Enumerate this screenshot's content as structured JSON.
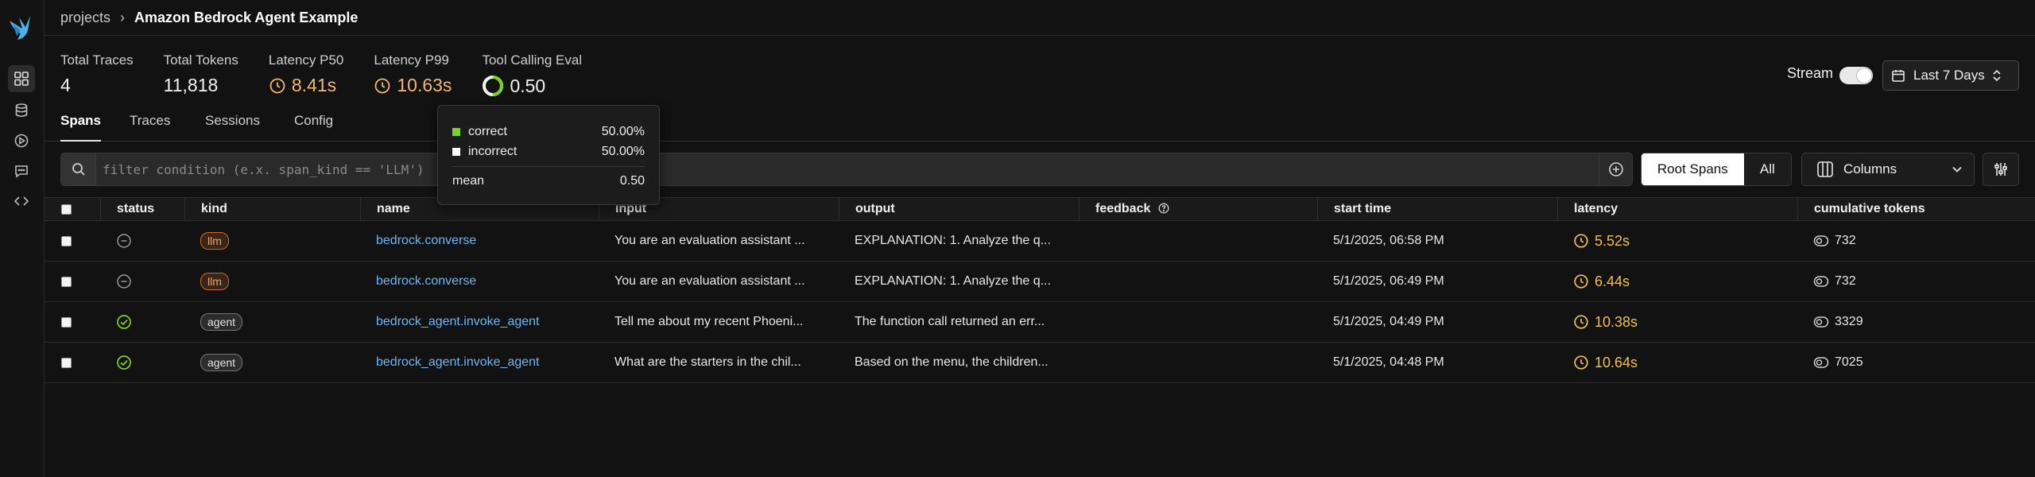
{
  "breadcrumb": {
    "root": "projects",
    "separator": "›",
    "current": "Amazon Bedrock Agent Example"
  },
  "stats": [
    {
      "label": "Total Traces",
      "value": "4"
    },
    {
      "label": "Total Tokens",
      "value": "11,818"
    },
    {
      "label": "Latency P50",
      "value": "8.41s"
    },
    {
      "label": "Latency P99",
      "value": "10.63s"
    },
    {
      "label": "Tool Calling Eval",
      "value": "0.50"
    }
  ],
  "eval_ring": {
    "correct_fraction": 0.5,
    "correct_color": "#7ed321"
  },
  "stream": {
    "label": "Stream",
    "on": true
  },
  "time_range": {
    "label": "Last 7 Days"
  },
  "tabs": [
    "Spans",
    "Traces",
    "Sessions",
    "Config"
  ],
  "filter": {
    "placeholder": "filter condition (e.x. span_kind == 'LLM')"
  },
  "scope": {
    "root": "Root Spans",
    "all": "All"
  },
  "columns_button": "Columns",
  "table": {
    "headers": [
      "status",
      "kind",
      "name",
      "input",
      "output",
      "feedback",
      "start time",
      "latency",
      "cumulative tokens"
    ],
    "rows": [
      {
        "status": "unset",
        "kind": "llm",
        "name": "bedrock.converse",
        "input": "You are an evaluation assistant ...",
        "output": "EXPLANATION: 1. Analyze the q...",
        "feedback": "",
        "start_time": "5/1/2025, 06:58 PM",
        "latency": "5.52s",
        "tokens": "732"
      },
      {
        "status": "unset",
        "kind": "llm",
        "name": "bedrock.converse",
        "input": "You are an evaluation assistant ...",
        "output": "EXPLANATION: 1. Analyze the q...",
        "feedback": "",
        "start_time": "5/1/2025, 06:49 PM",
        "latency": "6.44s",
        "tokens": "732"
      },
      {
        "status": "ok",
        "kind": "agent",
        "name": "bedrock_agent.invoke_agent",
        "input": "Tell me about my recent Phoeni...",
        "output": "The function call returned an err...",
        "feedback": "",
        "start_time": "5/1/2025, 04:49 PM",
        "latency": "10.38s",
        "tokens": "3329"
      },
      {
        "status": "ok",
        "kind": "agent",
        "name": "bedrock_agent.invoke_agent",
        "input": "What are the starters in the chil...",
        "output": "Based on the menu, the children...",
        "feedback": "",
        "start_time": "5/1/2025, 04:48 PM",
        "latency": "10.64s",
        "tokens": "7025"
      }
    ]
  },
  "tooltip": {
    "rows": [
      {
        "label": "correct",
        "value": "50.00%",
        "color": "#7ed321"
      },
      {
        "label": "incorrect",
        "value": "50.00%",
        "color": "#ffffff"
      }
    ],
    "mean_label": "mean",
    "mean_value": "0.50"
  },
  "colors": {
    "amber": "#f2b86b",
    "latency": "#f2c046",
    "link": "#6fb6f7",
    "ok": "#7ed321",
    "llm_badge": "#f2a571"
  }
}
